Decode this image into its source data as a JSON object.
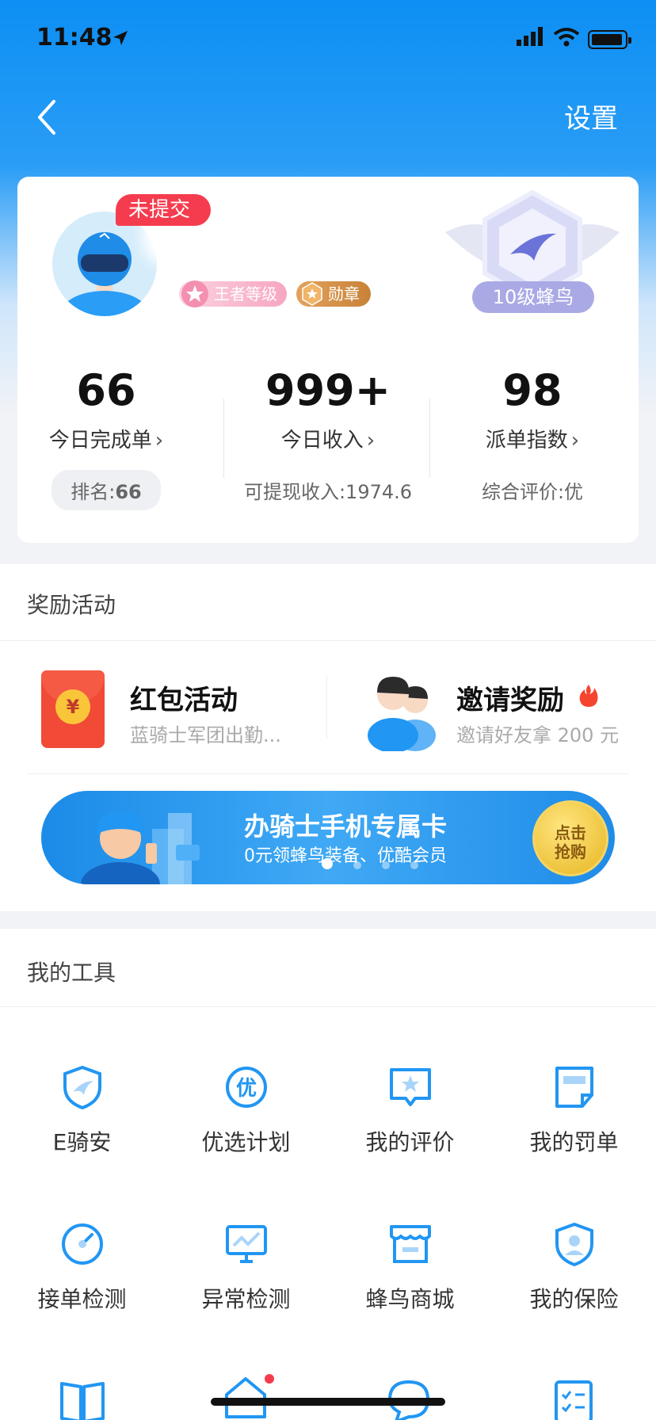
{
  "status_bar": {
    "time": "11:48"
  },
  "nav": {
    "settings_label": "设置"
  },
  "profile": {
    "status_tag": "未提交",
    "name": "",
    "level_badge": "王者等级",
    "medal_badge": "勋章",
    "rank_label": "10级蜂鸟"
  },
  "stats": [
    {
      "value": "66",
      "label": "今日完成单",
      "sub_label": "排名:",
      "sub_value": "66"
    },
    {
      "value": "999+",
      "label": "今日收入",
      "sub_label": "可提现收入:",
      "sub_value": "1974.6"
    },
    {
      "value": "98",
      "label": "派单指数",
      "sub_label": "综合评价:",
      "sub_value": "优"
    }
  ],
  "rewards": {
    "section_title": "奖励活动",
    "items": [
      {
        "title": "红包活动",
        "subtitle": "蓝骑士军团出勤..."
      },
      {
        "title": "邀请奖励",
        "subtitle": "邀请好友拿 200 元"
      }
    ],
    "banner": {
      "title": "办骑士手机专属卡",
      "subtitle": "0元领蜂鸟装备、优酷会员",
      "cta_line1": "点击",
      "cta_line2": "抢购"
    }
  },
  "tools": {
    "section_title": "我的工具",
    "items": [
      {
        "label": "E骑安",
        "icon": "shield-bird-icon"
      },
      {
        "label": "优选计划",
        "icon": "preferred-icon"
      },
      {
        "label": "我的评价",
        "icon": "star-chat-icon"
      },
      {
        "label": "我的罚单",
        "icon": "ticket-icon"
      },
      {
        "label": "接单检测",
        "icon": "gauge-icon"
      },
      {
        "label": "异常检测",
        "icon": "monitor-chart-icon"
      },
      {
        "label": "蜂鸟商城",
        "icon": "store-icon"
      },
      {
        "label": "我的保险",
        "icon": "insurance-icon"
      }
    ]
  },
  "colors": {
    "primary": "#0d8ff3",
    "tag_red": "#f53c4e",
    "icon_blue": "#2196f3"
  }
}
